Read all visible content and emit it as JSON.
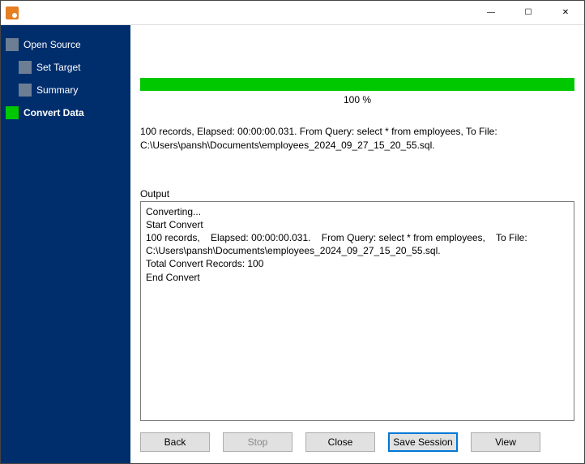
{
  "sidebar": {
    "items": [
      {
        "label": "Open Source",
        "level": 0,
        "active": false
      },
      {
        "label": "Set Target",
        "level": 1,
        "active": false
      },
      {
        "label": "Summary",
        "level": 1,
        "active": false
      },
      {
        "label": "Convert Data",
        "level": 0,
        "active": true
      }
    ]
  },
  "progress": {
    "percent_label": "100 %",
    "fill_percent": 100
  },
  "status": {
    "line1": "100 records,    Elapsed: 00:00:00.031.    From Query: select * from employees,    To File:",
    "line2": "C:\\Users\\pansh\\Documents\\employees_2024_09_27_15_20_55.sql."
  },
  "output": {
    "label": "Output",
    "text": "Converting...\nStart Convert\n100 records,    Elapsed: 00:00:00.031.    From Query: select * from employees,    To File: C:\\Users\\pansh\\Documents\\employees_2024_09_27_15_20_55.sql.\nTotal Convert Records: 100\nEnd Convert"
  },
  "buttons": {
    "back": "Back",
    "stop": "Stop",
    "close": "Close",
    "save_session": "Save Session",
    "view": "View"
  },
  "window_controls": {
    "min": "―",
    "max": "☐",
    "close": "✕"
  }
}
